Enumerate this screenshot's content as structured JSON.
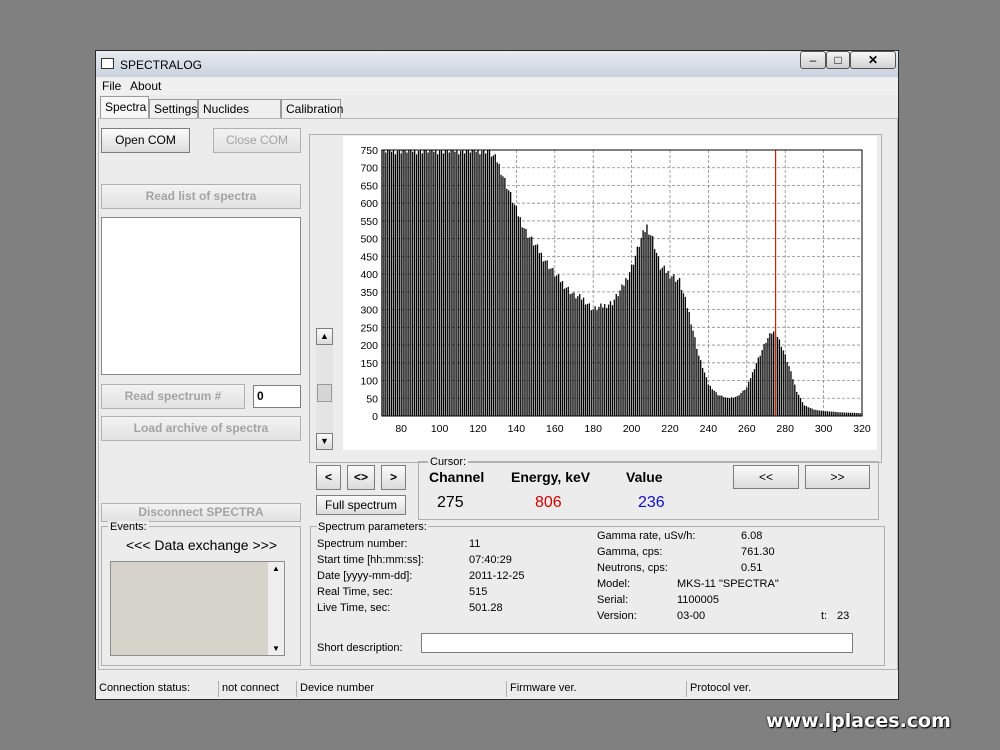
{
  "window": {
    "title": "SPECTRALOG",
    "minimize_icon": "minimize-icon",
    "maximize_icon": "maximize-icon",
    "close_icon": "close-icon"
  },
  "menu": [
    "File",
    "About"
  ],
  "tabs": [
    "Spectra",
    "Settings",
    "Nuclides library",
    "Calibration"
  ],
  "left": {
    "open_com": "Open COM",
    "close_com": "Close COM",
    "read_list": "Read list of spectra",
    "read_spectrum": "Read spectrum #",
    "spectrum_number_value": "0",
    "load_archive": "Load archive of spectra",
    "disconnect": "Disconnect SPECTRA",
    "events_label": "Events:",
    "data_exchange": "<<< Data exchange >>>"
  },
  "cursor": {
    "label": "Cursor:",
    "channel_header": "Channel",
    "energy_header": "Energy, keV",
    "value_header": "Value",
    "channel": "275",
    "energy": "806",
    "value": "236",
    "energy_color": "#d40000",
    "value_color": "#1010c8"
  },
  "controls": {
    "left": "<",
    "center": "<>",
    "right": ">",
    "full_spectrum": "Full spectrum",
    "prev": "<<",
    "next": ">>"
  },
  "params": {
    "title": "Spectrum parameters:",
    "rows": [
      {
        "label": "Spectrum number:",
        "value": "11"
      },
      {
        "label": "Start time [hh:mm:ss]:",
        "value": "07:40:29"
      },
      {
        "label": "Date [yyyy-mm-dd]:",
        "value": "2011-12-25"
      },
      {
        "label": "Real Time, sec:",
        "value": "515"
      },
      {
        "label": "Live Time, sec:",
        "value": "501.28"
      }
    ],
    "right_rows": [
      {
        "label": "Gamma rate, uSv/h:",
        "value": "6.08"
      },
      {
        "label": "Gamma, cps:",
        "value": "761.30"
      },
      {
        "label": "Neutrons, cps:",
        "value": "0.51"
      },
      {
        "label": "Model:",
        "value": "MKS-11 \"SPECTRA\""
      },
      {
        "label": "Serial:",
        "value": "1100005"
      },
      {
        "label": "Version:",
        "value": "03-00"
      }
    ],
    "t_label": "t:",
    "t_value": "23",
    "short_description_label": "Short description:",
    "short_description_value": ""
  },
  "status": {
    "connection_label": "Connection status:",
    "connection_value": "not connect",
    "device_label": "Device number",
    "firmware_label": "Firmware ver.",
    "protocol_label": "Protocol ver."
  },
  "watermark": "www.lplaces.com",
  "chart_data": {
    "type": "bar",
    "x_range": [
      70,
      320
    ],
    "y_range": [
      0,
      750
    ],
    "x_ticks": [
      80,
      100,
      120,
      140,
      160,
      180,
      200,
      220,
      240,
      260,
      280,
      300,
      320
    ],
    "y_ticks": [
      0,
      50,
      100,
      150,
      200,
      250,
      300,
      350,
      400,
      450,
      500,
      550,
      600,
      650,
      700,
      750
    ],
    "grid": true,
    "cursor_channel": 275,
    "cursor_color": "#d02000",
    "bar_color": "#000000",
    "profile": [
      [
        70,
        750
      ],
      [
        125,
        750
      ],
      [
        130,
        720
      ],
      [
        135,
        650
      ],
      [
        140,
        580
      ],
      [
        145,
        520
      ],
      [
        150,
        480
      ],
      [
        155,
        440
      ],
      [
        160,
        400
      ],
      [
        165,
        370
      ],
      [
        170,
        340
      ],
      [
        175,
        330
      ],
      [
        180,
        300
      ],
      [
        185,
        310
      ],
      [
        190,
        320
      ],
      [
        195,
        360
      ],
      [
        200,
        420
      ],
      [
        205,
        500
      ],
      [
        208,
        535
      ],
      [
        211,
        500
      ],
      [
        215,
        420
      ],
      [
        220,
        400
      ],
      [
        225,
        380
      ],
      [
        230,
        290
      ],
      [
        235,
        170
      ],
      [
        240,
        90
      ],
      [
        245,
        60
      ],
      [
        250,
        50
      ],
      [
        255,
        55
      ],
      [
        260,
        80
      ],
      [
        265,
        150
      ],
      [
        270,
        210
      ],
      [
        273,
        235
      ],
      [
        275,
        236
      ],
      [
        278,
        200
      ],
      [
        282,
        140
      ],
      [
        286,
        70
      ],
      [
        290,
        30
      ],
      [
        295,
        18
      ],
      [
        300,
        14
      ],
      [
        310,
        10
      ],
      [
        320,
        8
      ]
    ]
  }
}
